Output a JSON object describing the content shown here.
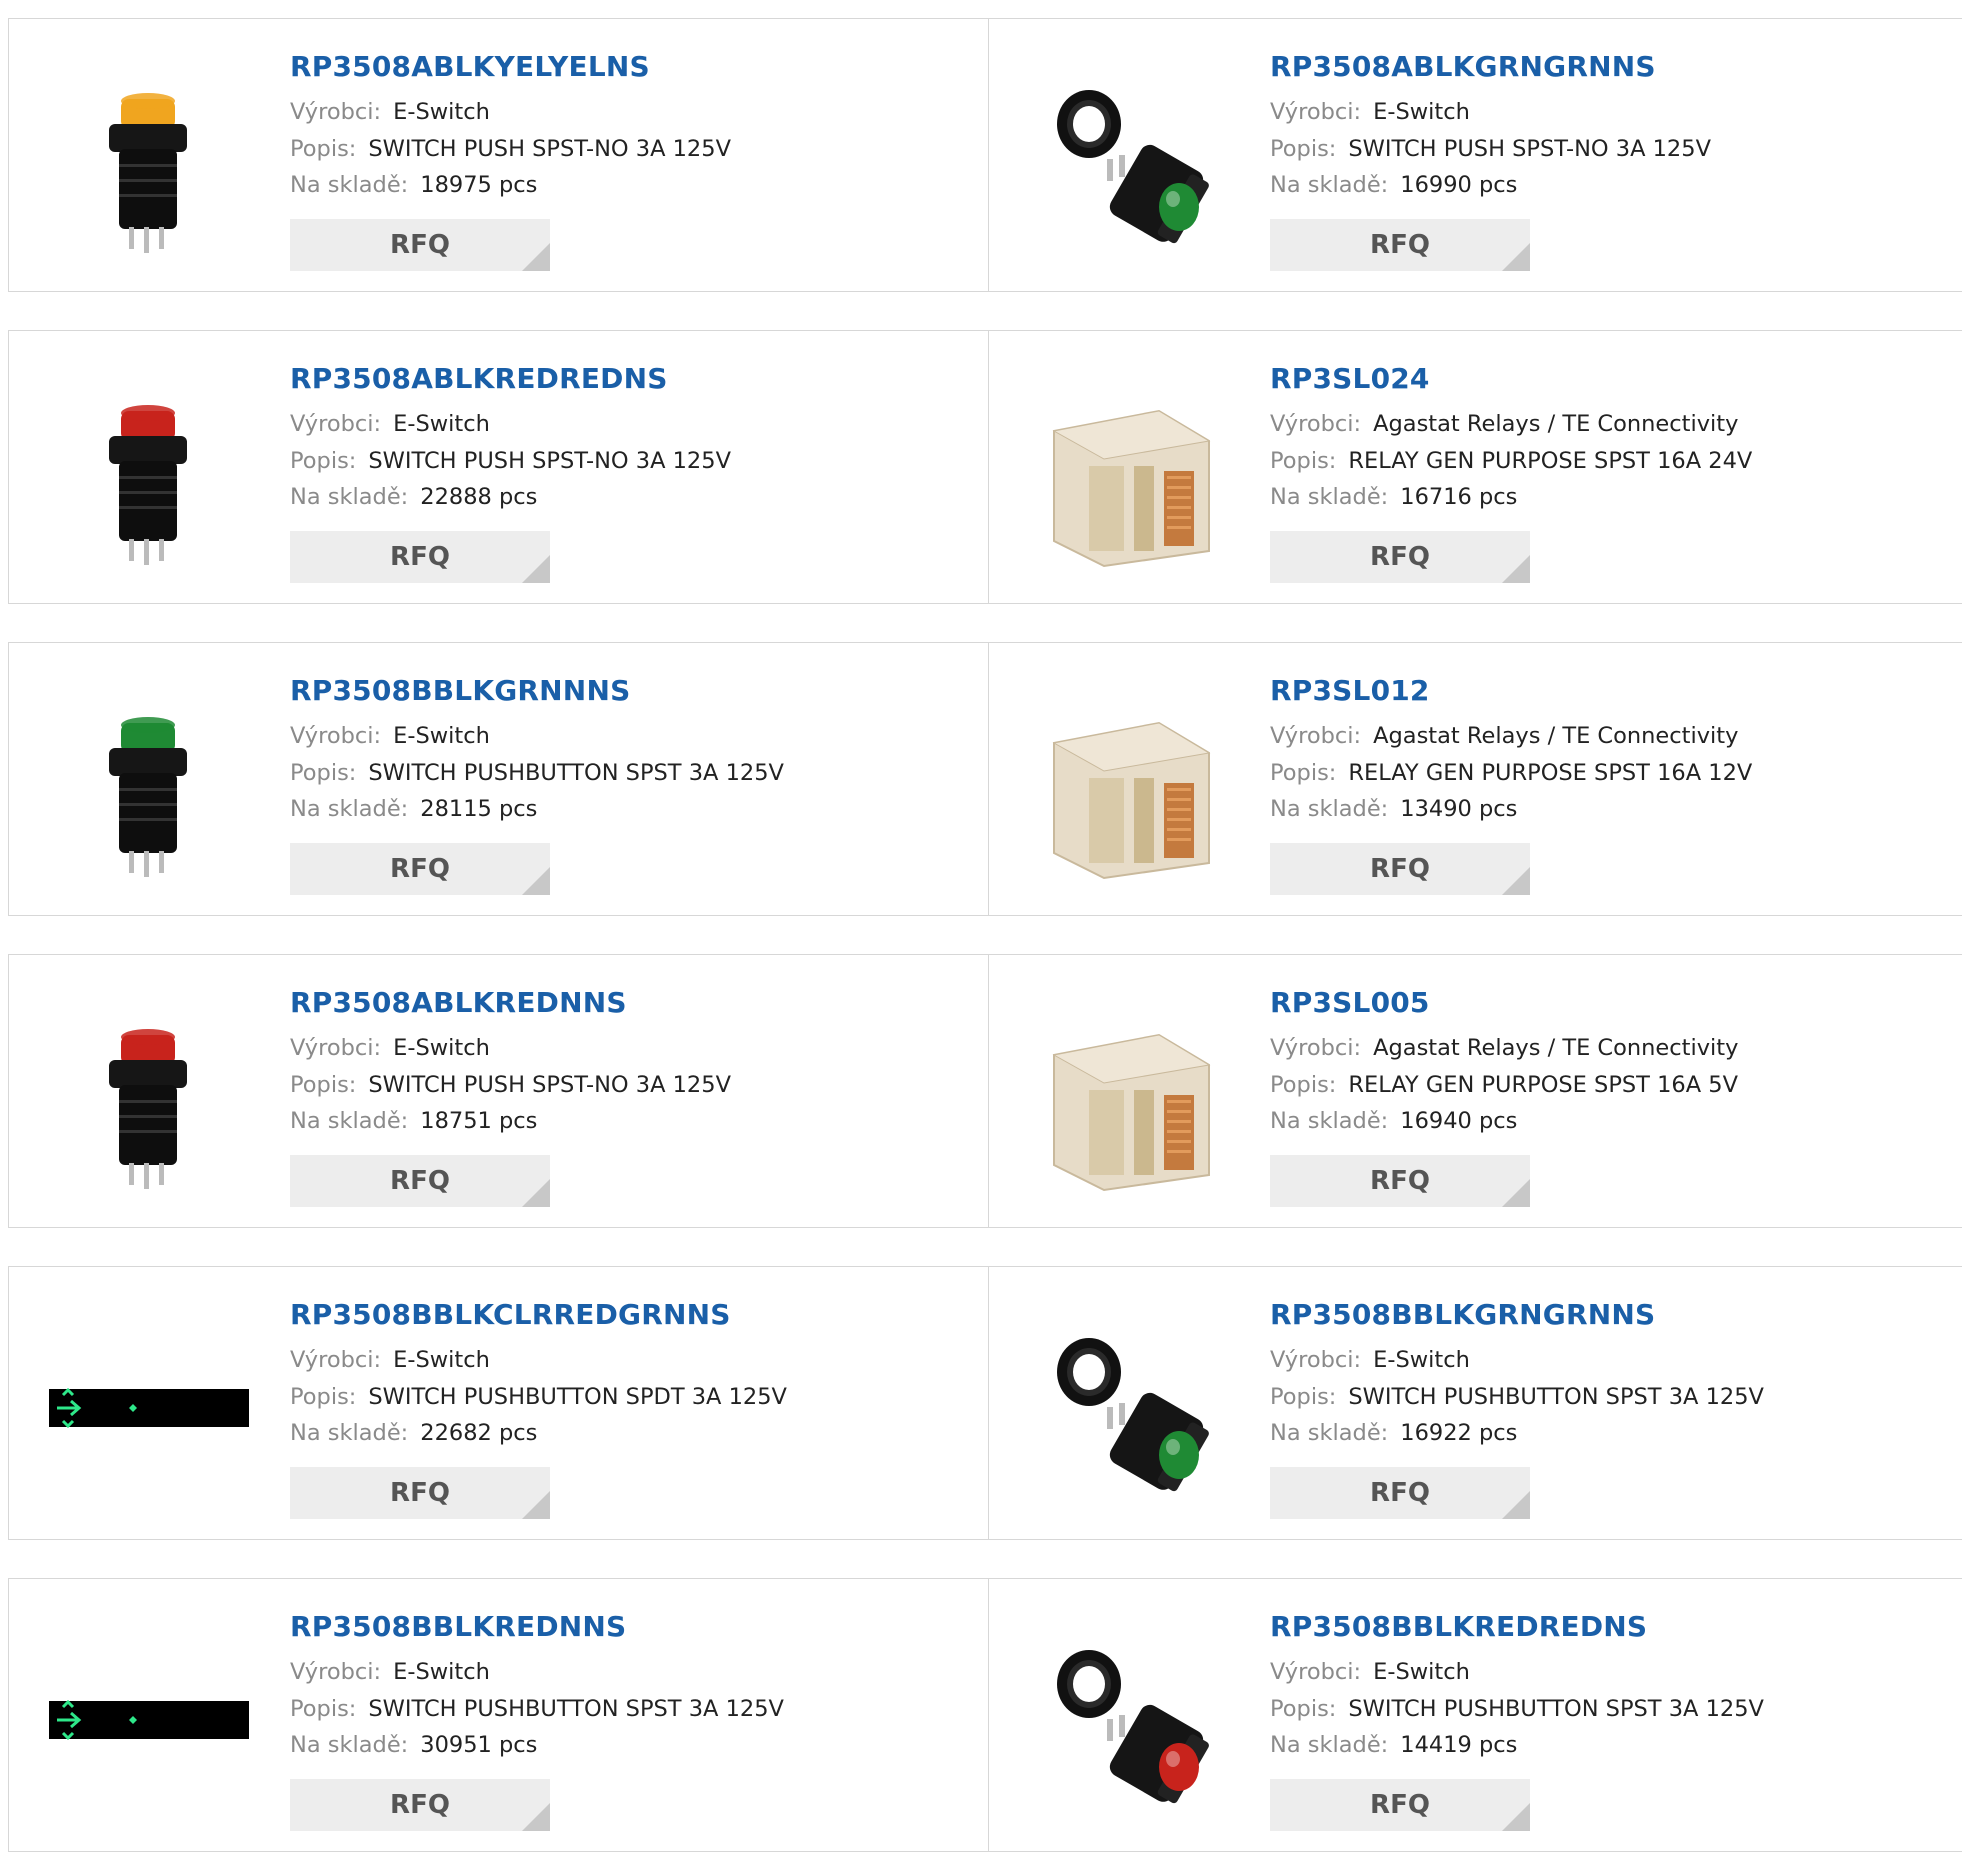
{
  "labels": {
    "manufacturer": "Výrobci:",
    "description": "Popis:",
    "stock": "Na skladě:",
    "rfq": "RFQ"
  },
  "colors": {
    "part_link": "#1a5fa8",
    "rfq_bg": "#ededed",
    "border": "#d7d7d7"
  },
  "products": [
    {
      "part": "RP3508ABLKYELYELNS",
      "manufacturer": "E-Switch",
      "description": "SWITCH PUSH SPST-NO 3A 125V",
      "stock": "18975 pcs",
      "image_icon": "yellow-pushbutton-switch"
    },
    {
      "part": "RP3508ABLKGRNGRNNS",
      "manufacturer": "E-Switch",
      "description": "SWITCH PUSH SPST-NO 3A 125V",
      "stock": "16990 pcs",
      "image_icon": "green-pushbutton-with-ring"
    },
    {
      "part": "RP3508ABLKREDREDNS",
      "manufacturer": "E-Switch",
      "description": "SWITCH PUSH SPST-NO 3A 125V",
      "stock": "22888 pcs",
      "image_icon": "red-pushbutton-switch"
    },
    {
      "part": "RP3SL024",
      "manufacturer": "Agastat Relays / TE Connectivity",
      "description": "RELAY GEN PURPOSE SPST 16A 24V",
      "stock": "16716 pcs",
      "image_icon": "relay"
    },
    {
      "part": "RP3508BBLKGRNNNS",
      "manufacturer": "E-Switch",
      "description": "SWITCH PUSHBUTTON SPST 3A 125V",
      "stock": "28115 pcs",
      "image_icon": "green-pushbutton-switch"
    },
    {
      "part": "RP3SL012",
      "manufacturer": "Agastat Relays / TE Connectivity",
      "description": "RELAY GEN PURPOSE SPST 16A 12V",
      "stock": "13490 pcs",
      "image_icon": "relay"
    },
    {
      "part": "RP3508ABLKREDNNS",
      "manufacturer": "E-Switch",
      "description": "SWITCH PUSH SPST-NO 3A 125V",
      "stock": "18751 pcs",
      "image_icon": "red-pushbutton-switch"
    },
    {
      "part": "RP3SL005",
      "manufacturer": "Agastat Relays / TE Connectivity",
      "description": "RELAY GEN PURPOSE SPST 16A 5V",
      "stock": "16940 pcs",
      "image_icon": "relay"
    },
    {
      "part": "RP3508BBLKCLRREDGRNNS",
      "manufacturer": "E-Switch",
      "description": "SWITCH PUSHBUTTON SPDT 3A 125V",
      "stock": "22682 pcs",
      "image_icon": "broken-image-placeholder"
    },
    {
      "part": "RP3508BBLKGRNGRNNS",
      "manufacturer": "E-Switch",
      "description": "SWITCH PUSHBUTTON SPST 3A 125V",
      "stock": "16922 pcs",
      "image_icon": "green-pushbutton-with-ring"
    },
    {
      "part": "RP3508BBLKREDNNS",
      "manufacturer": "E-Switch",
      "description": "SWITCH PUSHBUTTON SPST 3A 125V",
      "stock": "30951 pcs",
      "image_icon": "broken-image-placeholder"
    },
    {
      "part": "RP3508BBLKREDREDNS",
      "manufacturer": "E-Switch",
      "description": "SWITCH PUSHBUTTON SPST 3A 125V",
      "stock": "14419 pcs",
      "image_icon": "red-pushbutton-with-ring"
    }
  ]
}
